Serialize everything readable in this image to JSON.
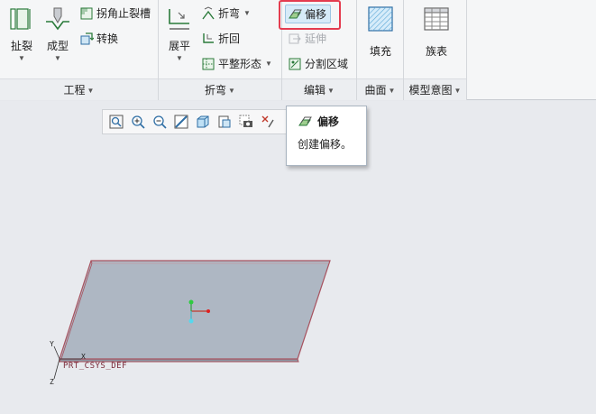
{
  "ribbon": {
    "groups": {
      "engineering": {
        "label": "工程",
        "buttons": {
          "rip": "扯裂",
          "form": "成型",
          "corner_relief": "拐角止裂槽",
          "convert": "转换"
        }
      },
      "bend": {
        "label": "折弯",
        "buttons": {
          "flatten": "展平",
          "bend": "折弯",
          "unbend": "折回",
          "flat_pattern": "平整形态"
        }
      },
      "editing": {
        "label": "编辑",
        "buttons": {
          "offset": "偏移",
          "extend": "延伸",
          "split_area": "分割区域"
        }
      },
      "surfaces": {
        "label": "曲面",
        "buttons": {
          "fill": "填充"
        }
      },
      "model_intent": {
        "label": "模型意图",
        "buttons": {
          "family_table": "族表"
        }
      }
    }
  },
  "tooltip": {
    "title": "偏移",
    "description": "创建偏移。"
  },
  "graphics": {
    "csys_label": "PRT_CSYS_DEF",
    "axes": {
      "x": "X",
      "y": "Y",
      "z": "Z"
    }
  },
  "colors": {
    "part_fill": "#aeb7c3",
    "edge": "#a8525f",
    "highlight": "#e43c4f"
  }
}
